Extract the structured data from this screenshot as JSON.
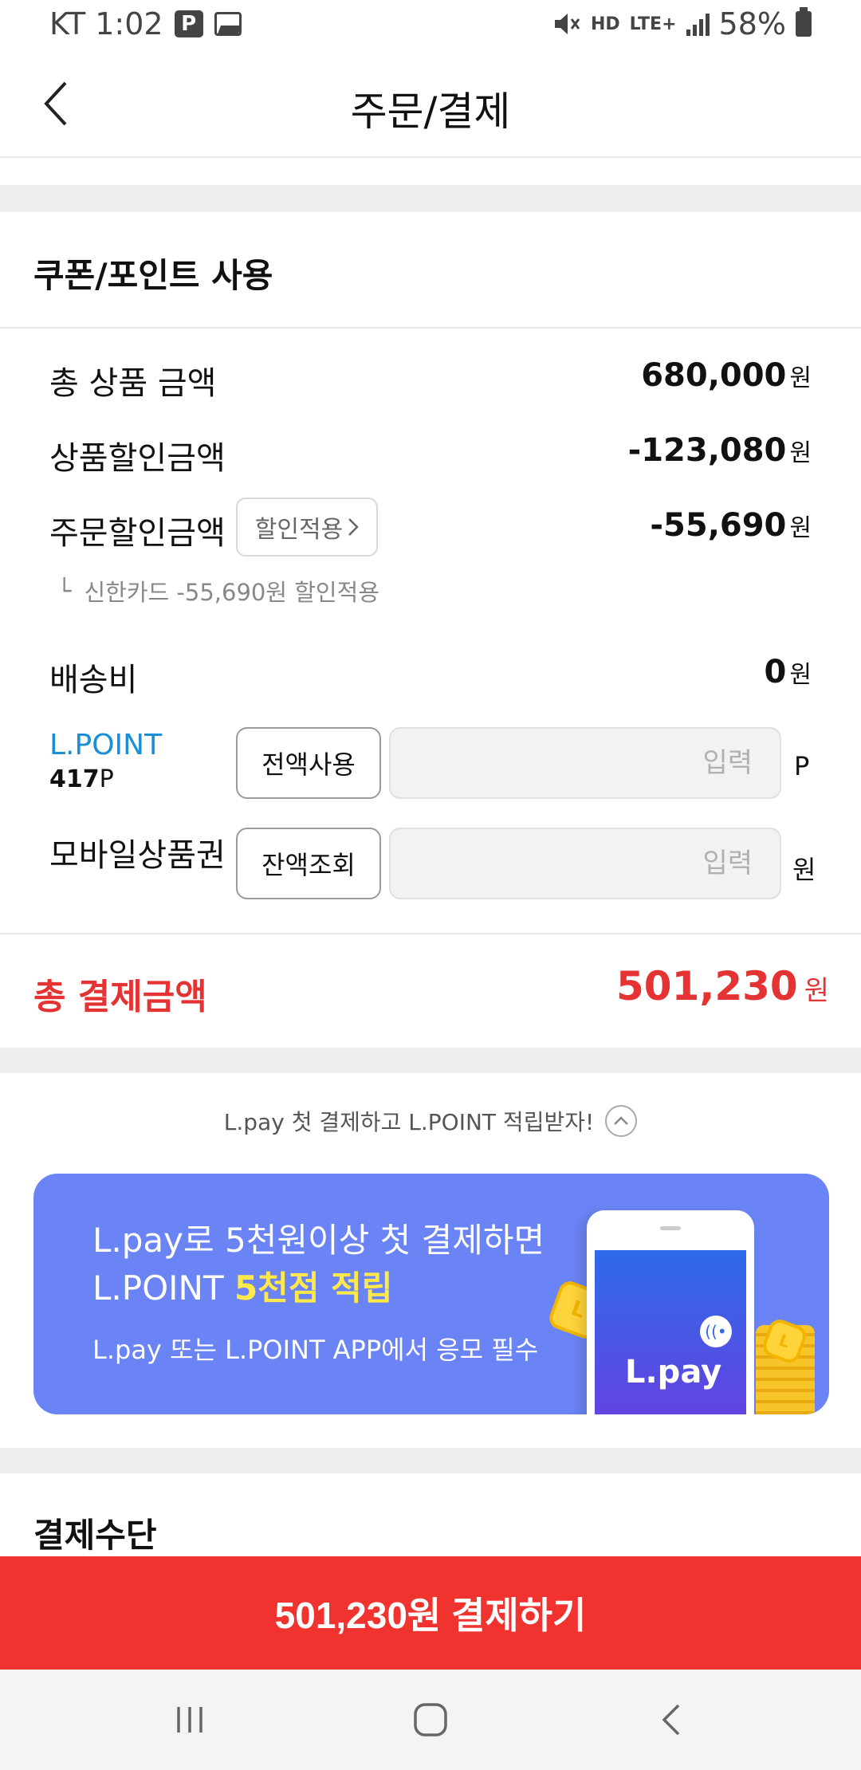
{
  "status_bar": {
    "carrier_time": "KT 1:02",
    "parking_icon_label": "P",
    "hd_label": "HD",
    "lte_label": "LTE+",
    "battery": "58%"
  },
  "header": {
    "title": "주문/결제"
  },
  "coupon_section": {
    "title": "쿠폰/포인트 사용",
    "rows": [
      {
        "label": "총 상품 금액",
        "value": "680,000",
        "unit": "원"
      },
      {
        "label": "상품할인금액",
        "value": "-123,080",
        "unit": "원"
      },
      {
        "label": "주문할인금액",
        "value": "-55,690",
        "unit": "원"
      },
      {
        "label": "배송비",
        "value": "0",
        "unit": "원"
      }
    ],
    "discount_apply_button": "할인적용",
    "discount_note_prefix": "└",
    "discount_note": "신한카드 -55,690원 할인적용",
    "lpoint": {
      "name": "L.POINT",
      "balance_num": "417",
      "balance_unit": "P",
      "use_all_button": "전액사용",
      "placeholder": "입력",
      "unit": "P"
    },
    "gift_card": {
      "label": "모바일상품권",
      "balance_button": "잔액조회",
      "placeholder": "입력",
      "unit": "원"
    }
  },
  "total": {
    "label": "총 결제금액",
    "value": "501,230",
    "unit": "원"
  },
  "promo": {
    "text": "L.pay 첫 결제하고 L.POINT 적립받자!",
    "banner_line1": "L.pay로 5천원이상 첫 결제하면",
    "banner_line2_prefix": "L.POINT ",
    "banner_line2_highlight": "5천점 적립",
    "banner_sub": "L.pay 또는 L.POINT APP에서 응모 필수",
    "phone_logo": "L.pay",
    "coin_letter": "L"
  },
  "payment_method": {
    "title": "결제수단"
  },
  "pay_button": {
    "label": "501,230원 결제하기"
  },
  "colors": {
    "accent_red": "#f0332f",
    "total_red": "#e53232",
    "lpoint_blue": "#1a8ed6",
    "banner_blue": "#6b84f5",
    "highlight_yellow": "#ffe94a"
  }
}
